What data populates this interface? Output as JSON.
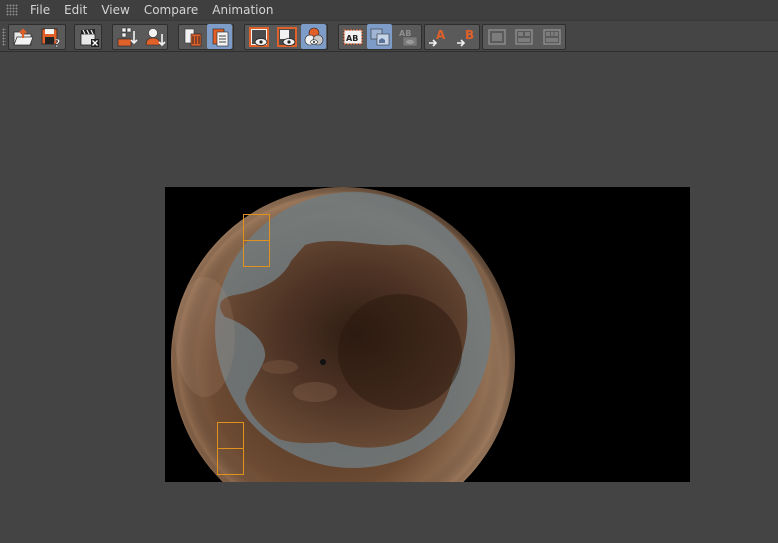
{
  "menu": {
    "items": [
      "File",
      "Edit",
      "View",
      "Compare",
      "Animation"
    ]
  },
  "toolbar": {
    "buttons": [
      {
        "name": "open-folder-icon",
        "active": false
      },
      {
        "name": "save-unknown-icon",
        "active": false
      },
      {
        "name": "clapperboard-remove-icon",
        "active": false
      },
      {
        "name": "grid-down-icon",
        "active": false
      },
      {
        "name": "user-down-icon",
        "active": false
      },
      {
        "name": "delete-file-icon",
        "active": false
      },
      {
        "name": "document-list-icon",
        "active": true
      },
      {
        "name": "view-a-icon",
        "active": false
      },
      {
        "name": "view-b-icon",
        "active": false
      },
      {
        "name": "channels-icon",
        "active": true
      },
      {
        "name": "ab-side-by-side-icon",
        "active": false
      },
      {
        "name": "ab-wipe-icon",
        "active": true
      },
      {
        "name": "ab-split-icon",
        "active": false
      },
      {
        "name": "set-a-icon",
        "active": false
      },
      {
        "name": "set-b-icon",
        "active": false
      },
      {
        "name": "layout-one-icon",
        "active": false
      },
      {
        "name": "layout-two-icon",
        "active": false
      },
      {
        "name": "layout-three-icon",
        "active": false
      }
    ],
    "labels": {
      "ab": "AB",
      "a": "A",
      "b": "B"
    }
  },
  "colors": {
    "accent_orange": "#e0602a",
    "active_blue": "#7d9cc7",
    "region_outline": "#e0921c",
    "viewport_bg": "#444444"
  }
}
